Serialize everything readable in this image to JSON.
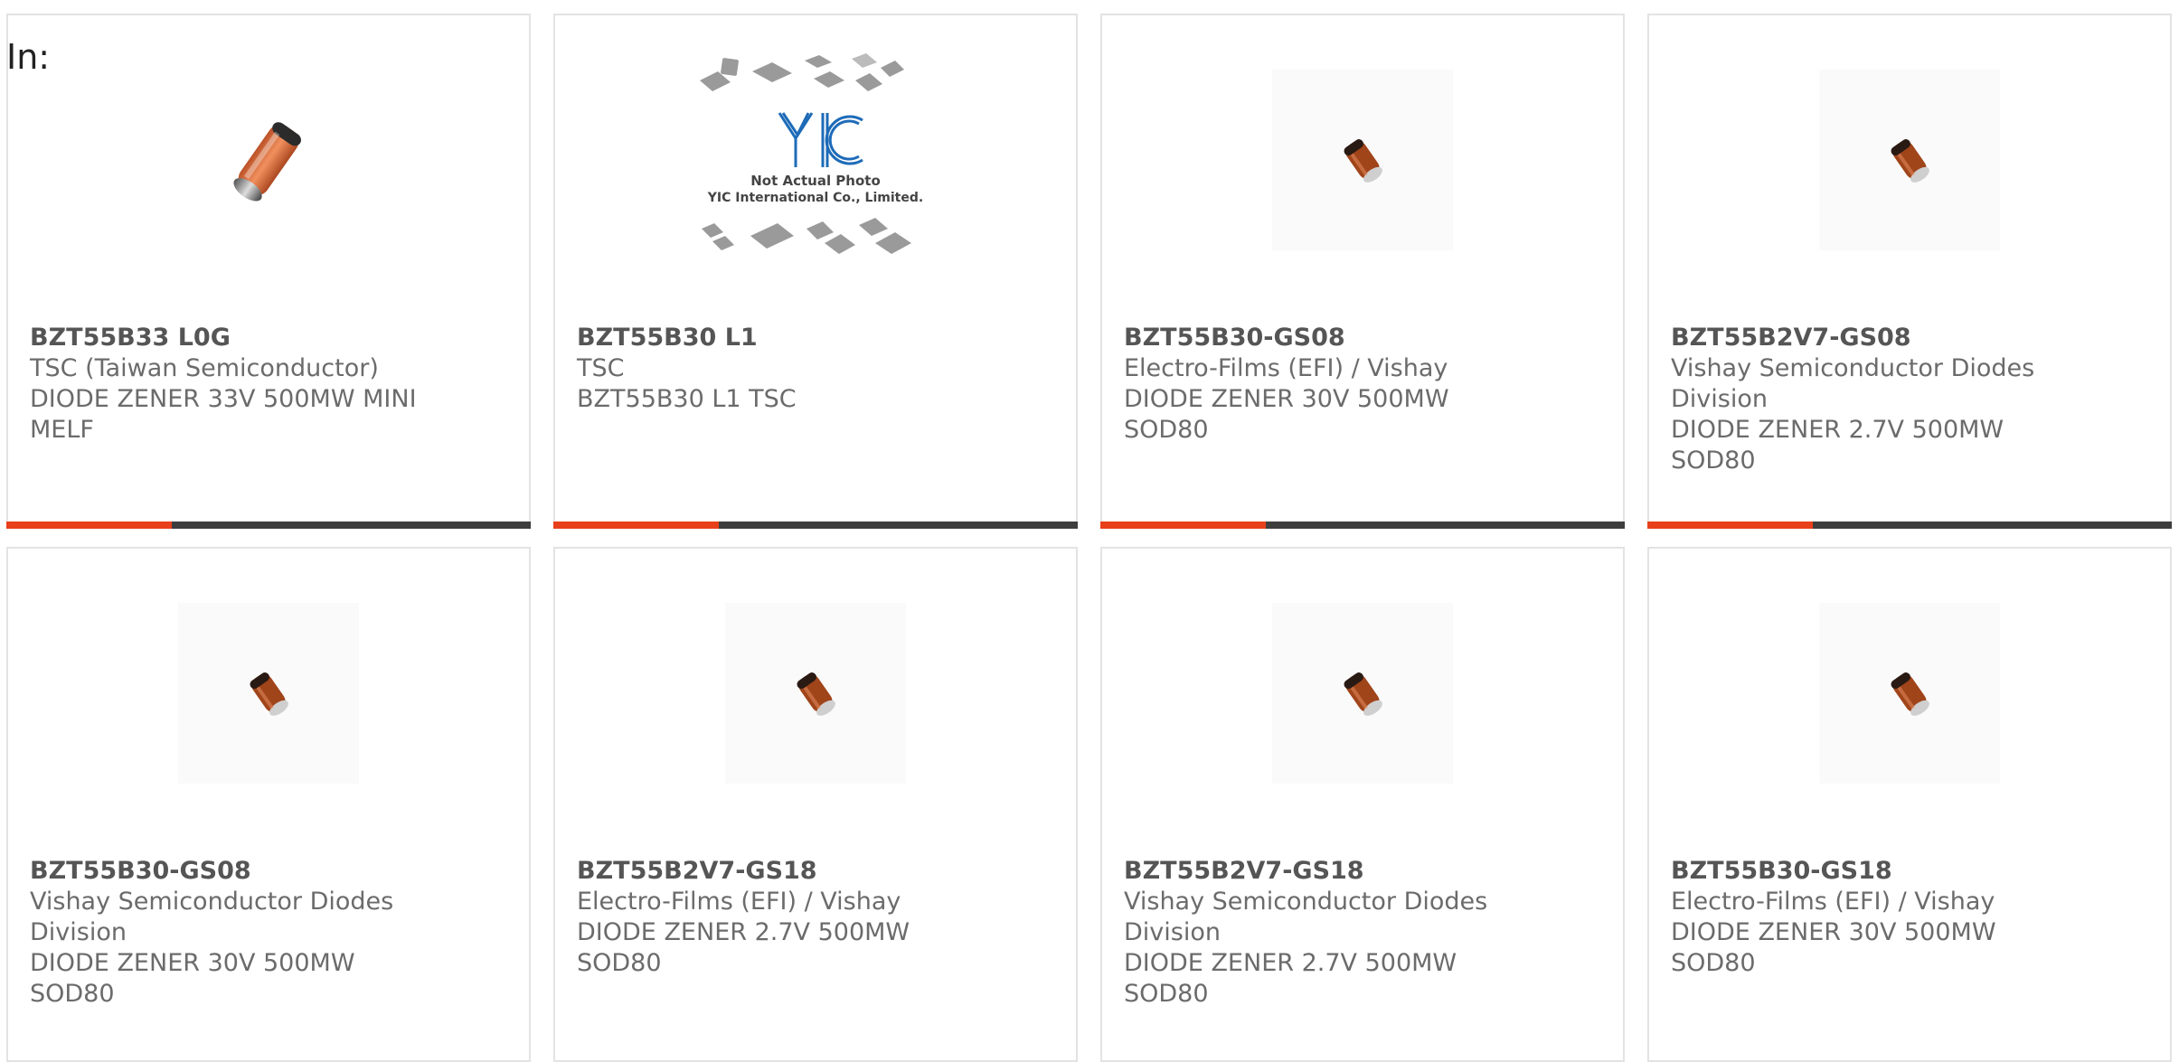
{
  "filter_label": "In:",
  "colors": {
    "accent": "#e8401b",
    "bar_dark": "#3e3e3e",
    "border": "#e3e3e3",
    "text": "#6b6b6b"
  },
  "products": [
    {
      "part": "BZT55B33 L0G",
      "manufacturer": "TSC (Taiwan Semiconductor)",
      "description": "DIODE ZENER 33V 500MW MINI MELF",
      "image": "mini-melf-diode-photo",
      "show_bar": true
    },
    {
      "part": "BZT55B30 L1",
      "manufacturer": "TSC",
      "description": "BZT55B30 L1 TSC",
      "image": "placeholder-ic-photo",
      "placeholder_line1": "Not Actual Photo",
      "placeholder_line2": "YIC International Co., Limited.",
      "show_bar": true
    },
    {
      "part": "BZT55B30-GS08",
      "manufacturer": "Electro-Films (EFI) / Vishay",
      "description": "DIODE ZENER 30V 500MW SOD80",
      "image": "sod80-diode-photo",
      "show_bar": true
    },
    {
      "part": "BZT55B2V7-GS08",
      "manufacturer": "Vishay Semiconductor Diodes Division",
      "description": "DIODE ZENER 2.7V 500MW SOD80",
      "image": "sod80-diode-photo",
      "show_bar": true
    },
    {
      "part": "BZT55B30-GS08",
      "manufacturer": "Vishay Semiconductor Diodes Division",
      "description": "DIODE ZENER 30V 500MW SOD80",
      "image": "sod80-diode-photo",
      "show_bar": false
    },
    {
      "part": "BZT55B2V7-GS18",
      "manufacturer": "Electro-Films (EFI) / Vishay",
      "description": "DIODE ZENER 2.7V 500MW SOD80",
      "image": "sod80-diode-photo",
      "show_bar": false
    },
    {
      "part": "BZT55B2V7-GS18",
      "manufacturer": "Vishay Semiconductor Diodes Division",
      "description": "DIODE ZENER 2.7V 500MW SOD80",
      "image": "sod80-diode-photo",
      "show_bar": false
    },
    {
      "part": "BZT55B30-GS18",
      "manufacturer": "Electro-Films (EFI) / Vishay",
      "description": "DIODE ZENER 30V 500MW SOD80",
      "image": "sod80-diode-photo",
      "show_bar": false
    }
  ]
}
